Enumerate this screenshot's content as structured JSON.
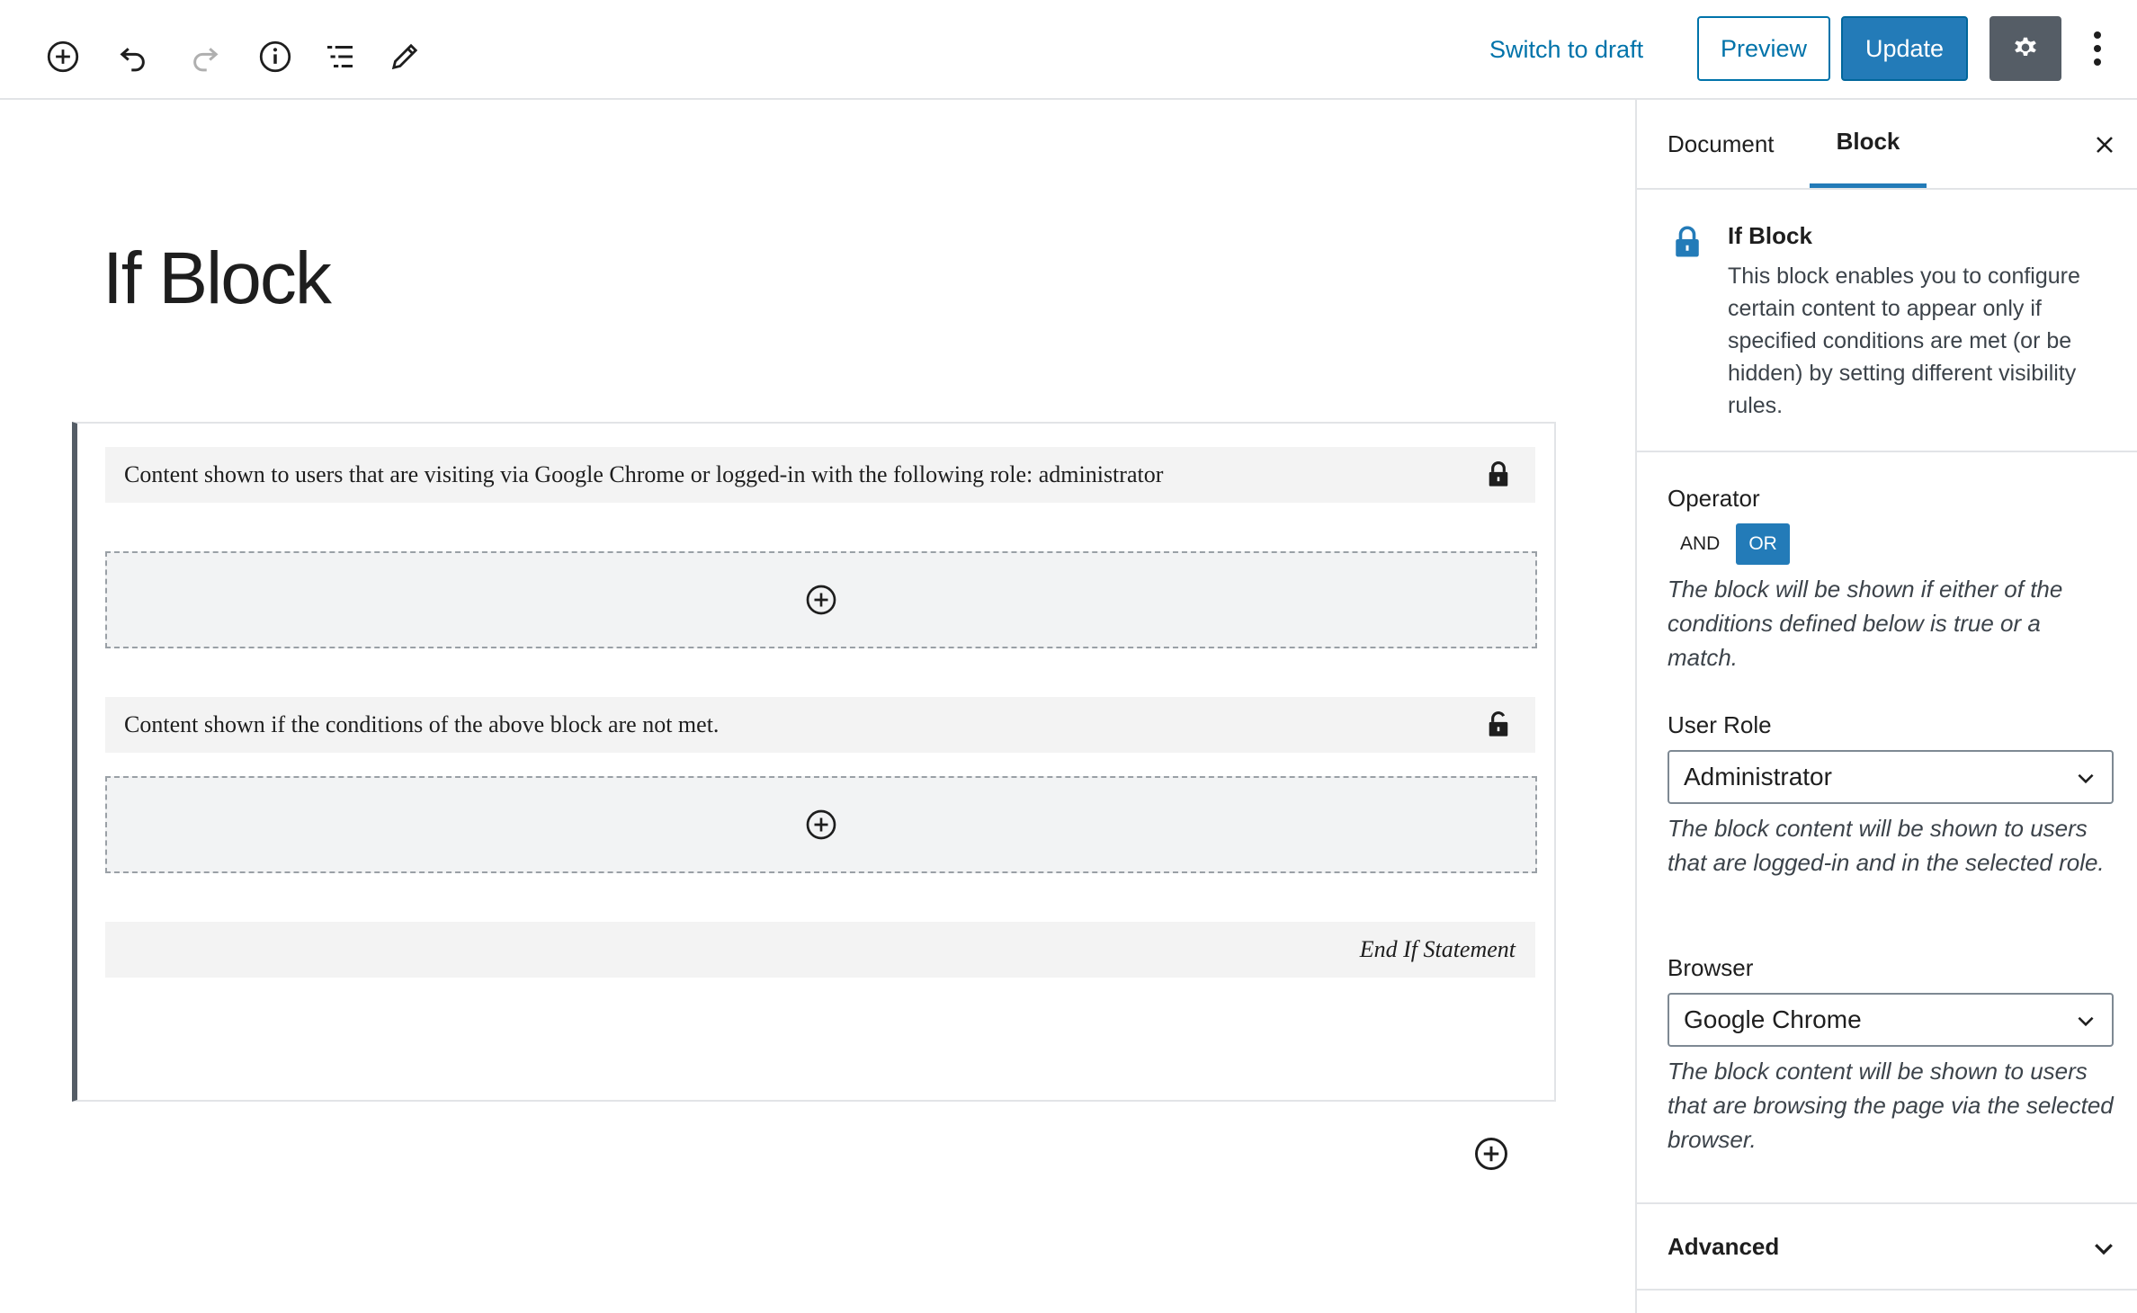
{
  "toolbar": {
    "icons": [
      "add-block-icon",
      "undo-icon",
      "redo-icon",
      "info-icon",
      "outline-icon",
      "tools-icon"
    ],
    "switch_to_draft": "Switch to draft",
    "preview": "Preview",
    "update": "Update"
  },
  "editor": {
    "title": "If Block",
    "if_condition": "Content shown to users that are visiting via Google Chrome or logged-in with the following role: administrator",
    "else_condition": "Content shown if the conditions of the above block are not met.",
    "end_statement": "End If Statement"
  },
  "sidebar": {
    "tabs": {
      "document": "Document",
      "block": "Block",
      "active": "Block"
    },
    "block": {
      "name": "If Block",
      "description": "This block enables you to configure certain content to appear only if specified conditions are met (or be hidden) by setting different visibility rules."
    },
    "operator": {
      "label": "Operator",
      "options": [
        "AND",
        "OR"
      ],
      "selected": "OR",
      "help": "The block will be shown if either of the conditions defined below is true or a match."
    },
    "user_role": {
      "label": "User Role",
      "value": "Administrator",
      "help": "The block content will be shown to users that are logged-in and in the selected role."
    },
    "browser": {
      "label": "Browser",
      "value": "Google Chrome",
      "help": "The block content will be shown to users that are browsing the page via the selected browser."
    },
    "advanced": "Advanced"
  },
  "colors": {
    "accent": "#237bb8",
    "link": "#0073aa",
    "dark_button": "#555d66",
    "bar_bg": "#f3f3f3"
  }
}
